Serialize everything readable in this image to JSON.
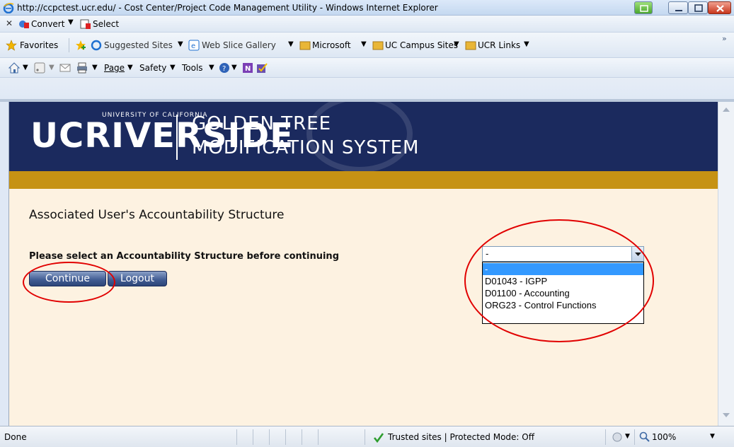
{
  "window": {
    "title": "http://ccpctest.ucr.edu/ - Cost Center/Project Code Management Utility - Windows Internet Explorer"
  },
  "toolbar1": {
    "close_glyph": "✕",
    "convert_label": "Convert",
    "select_label": "Select"
  },
  "favorites_bar": {
    "favorites_label": "Favorites",
    "items": [
      {
        "label": "Suggested Sites"
      },
      {
        "label": "Web Slice Gallery"
      },
      {
        "label": "Microsoft"
      },
      {
        "label": "UC Campus Sites"
      },
      {
        "label": "UCR Links"
      }
    ],
    "overflow_glyph": "»"
  },
  "command_bar": {
    "page_label": "Page",
    "safety_label": "Safety",
    "tools_label": "Tools"
  },
  "banner": {
    "logo_main": "UCRIVERSIDE",
    "logo_tag": "UNIVERSITY OF CALIFORNIA",
    "title_line1": "GOLDEN TREE",
    "title_line2": "MODIFICATION SYSTEM"
  },
  "main": {
    "heading": "Associated User's Accountability Structure",
    "prompt": "Please select an Accountability Structure before continuing",
    "continue_label": "Continue",
    "logout_label": "Logout",
    "select": {
      "value": "-",
      "options": [
        {
          "label": "-",
          "selected": true
        },
        {
          "label": "D01043 - IGPP",
          "selected": false
        },
        {
          "label": "D01100 - Accounting",
          "selected": false
        },
        {
          "label": "ORG23 - Control Functions",
          "selected": false
        }
      ]
    }
  },
  "status_bar": {
    "status_text": "Done",
    "zone_text": "Trusted sites | Protected Mode: Off",
    "zoom": "100%"
  },
  "colors": {
    "banner_navy": "#1b2a5e",
    "banner_gold": "#c69214",
    "page_bg": "#fdf2e1",
    "annotation_red": "#e10000",
    "selection_blue": "#3399ff"
  }
}
